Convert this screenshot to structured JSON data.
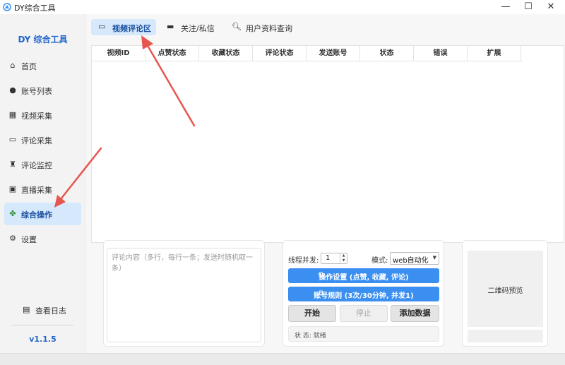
{
  "window": {
    "title": "DY综合工具",
    "minimize": "—",
    "maximize": "☐",
    "close": "✕"
  },
  "sidebar": {
    "brand": "DY 综合工具",
    "items": [
      {
        "label": "首页",
        "icon": "home-icon"
      },
      {
        "label": "账号列表",
        "icon": "user-icon"
      },
      {
        "label": "视频采集",
        "icon": "film-icon"
      },
      {
        "label": "评论采集",
        "icon": "comment-icon"
      },
      {
        "label": "评论监控",
        "icon": "monitor-icon"
      },
      {
        "label": "直播采集",
        "icon": "tv-icon"
      },
      {
        "label": "综合操作",
        "icon": "puzzle-icon"
      },
      {
        "label": "设置",
        "icon": "gear-icon"
      }
    ],
    "active_index": 6,
    "log_label": "查看日志",
    "version": "v1.1.5"
  },
  "tabs": [
    {
      "label": "视频评论区",
      "icon": "comment-icon"
    },
    {
      "label": "关注/私信",
      "icon": "inbox-icon"
    },
    {
      "label": "用户资料查询",
      "icon": "search-icon"
    }
  ],
  "table": {
    "columns": [
      "视频ID",
      "点赞状态",
      "收藏状态",
      "评论状态",
      "发送账号",
      "状态",
      "错误",
      "扩展"
    ],
    "rows": []
  },
  "comment": {
    "placeholder": "评论内容（多行，每行一条；发送时随机取一条）"
  },
  "controls": {
    "threads_label": "线程并发:",
    "threads_value": "1",
    "mode_label": "模式:",
    "mode_value": "web自动化",
    "op_settings_label": "操作设置 (点赞, 收藏, 评论)",
    "account_rules_label": "账号规则 (3次/30分钟, 并发1)",
    "start_label": "开始",
    "stop_label": "停止",
    "add_data_label": "添加数据",
    "status_label": "状 态:",
    "status_value": "就绪"
  },
  "qr": {
    "label": "二维码预览"
  },
  "colors": {
    "accent": "#3b8ff0",
    "active_bg": "#d6e8fb",
    "brand": "#2266cc",
    "arrow": "#e8554e"
  }
}
